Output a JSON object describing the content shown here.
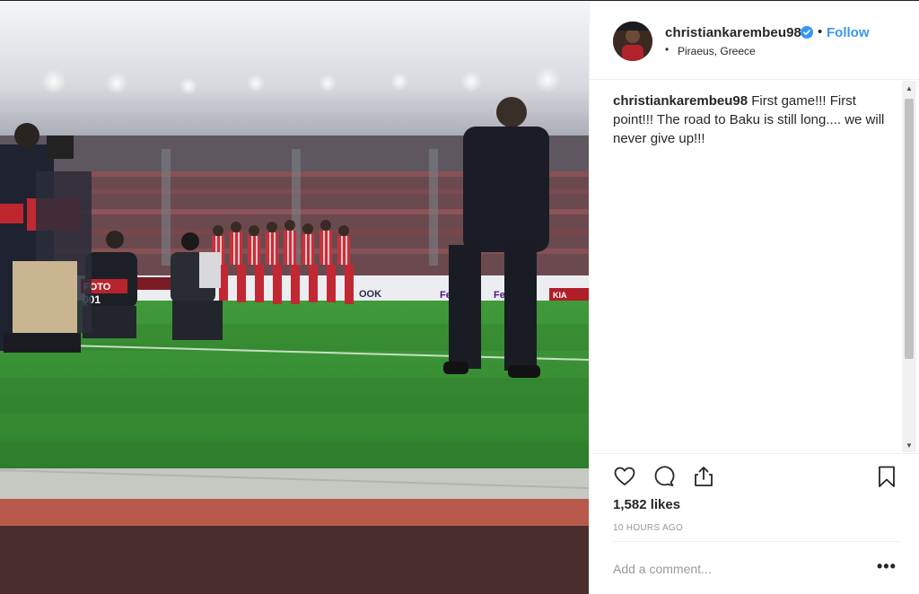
{
  "post": {
    "username": "christiankarembeu98",
    "verified": true,
    "follow_label": "Follow",
    "separator": "•",
    "location": "Piraeus, Greece",
    "caption_author": "christiankarembeu98",
    "caption_text": "First game!!! First point!!! The road to Baku is still long.... we will never give up!!!",
    "likes": "1,582 likes",
    "time_ago": "10 HOURS AGO",
    "comment_placeholder": "Add a comment...",
    "more_label": "•••"
  },
  "photo": {
    "ad_boards": [
      "FedEx",
      "Fed",
      "KIA",
      "OOK",
      "FOTO",
      "001"
    ]
  },
  "colors": {
    "accent": "#3897f0",
    "text": "#262626",
    "muted": "#999999",
    "divider": "#efefef"
  },
  "icons": [
    "verified-badge-icon",
    "heart-icon",
    "comment-icon",
    "share-icon",
    "bookmark-icon",
    "more-options-icon"
  ]
}
